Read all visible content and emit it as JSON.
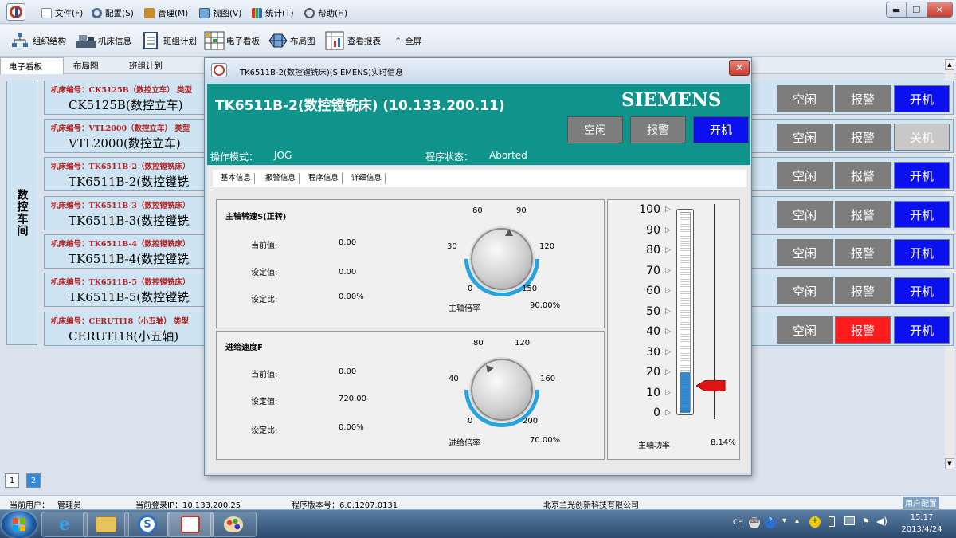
{
  "menu": {
    "items": [
      "文件(F)",
      "配置(S)",
      "管理(M)",
      "视图(V)",
      "统计(T)",
      "帮助(H)"
    ]
  },
  "window_controls": {
    "minimize": "▬",
    "restore": "❐",
    "close": "✕"
  },
  "toolbar": {
    "items": [
      "组织结构",
      "机床信息",
      "班组计划",
      "电子看板",
      "布局图",
      "查看报表",
      "全屏"
    ]
  },
  "tabs": [
    "电子看板",
    "布局图",
    "班组计划"
  ],
  "workshop_label": "数控车间",
  "machines": [
    {
      "code": "机床编号：CK5125B（数控立车）  类型",
      "name": "CK5125B(数控立车)",
      "idle": "空闲",
      "alarm": "报警",
      "power": "开机",
      "alarm_active": false,
      "power_on": true
    },
    {
      "code": "机床编号：VTL2000（数控立车）  类型",
      "name": "VTL2000(数控立车)",
      "idle": "空闲",
      "alarm": "报警",
      "power": "关机",
      "alarm_active": false,
      "power_on": false
    },
    {
      "code": "机床编号：TK6511B-2（数控镗铣床）",
      "name": "TK6511B-2(数控镗铣",
      "idle": "空闲",
      "alarm": "报警",
      "power": "开机",
      "alarm_active": false,
      "power_on": true
    },
    {
      "code": "机床编号：TK6511B-3（数控镗铣床）",
      "name": "TK6511B-3(数控镗铣",
      "idle": "空闲",
      "alarm": "报警",
      "power": "开机",
      "alarm_active": false,
      "power_on": true
    },
    {
      "code": "机床编号：TK6511B-4（数控镗铣床）",
      "name": "TK6511B-4(数控镗铣",
      "idle": "空闲",
      "alarm": "报警",
      "power": "开机",
      "alarm_active": false,
      "power_on": true
    },
    {
      "code": "机床编号：TK6511B-5（数控镗铣床）",
      "name": "TK6511B-5(数控镗铣",
      "idle": "空闲",
      "alarm": "报警",
      "power": "开机",
      "alarm_active": false,
      "power_on": true
    },
    {
      "code": "机床编号：CERUTI18（小五轴）  类型",
      "name": "CERUTI18(小五轴)",
      "idle": "空闲",
      "alarm": "报警",
      "power": "开机",
      "alarm_active": true,
      "power_on": true
    }
  ],
  "pager": {
    "pages": [
      "1",
      "2"
    ],
    "current": "2"
  },
  "status": {
    "user_label": "当前用户：",
    "user": "管理员",
    "ip_label": "当前登录IP：10.133.200.25",
    "version_label": "程序版本号：6.0.1207.0131",
    "company": "北京兰光创新科技有限公司",
    "config": "用户配置"
  },
  "taskbar": {
    "tray_lang": "CH",
    "time": "15:17",
    "date": "2013/4/24"
  },
  "dialog": {
    "title": "TK6511B-2(数控镗铣床)(SIEMENS)实时信息",
    "close": "✕",
    "machine_title": "TK6511B-2(数控镗铣床) (10.133.200.11)",
    "brand": "SIEMENS",
    "buttons": {
      "idle": "空闲",
      "alarm": "报警",
      "power": "开机"
    },
    "op_mode_label": "操作模式：",
    "op_mode": "JOG",
    "prog_state_label": "程序状态：",
    "prog_state": "Aborted",
    "subtabs": [
      "基本信息",
      "报警信息",
      "程序信息",
      "详细信息"
    ],
    "spindle": {
      "title": "主轴转速S(正转)",
      "current_label": "当前值:",
      "current": "0.00",
      "set_label": "设定值:",
      "set": "0.00",
      "ratio_label": "设定比:",
      "ratio": "0.00%",
      "dial_ticks": [
        "0",
        "30",
        "60",
        "90",
        "120",
        "150"
      ],
      "override_label": "主轴倍率",
      "override": "90.00%",
      "override_value": 90
    },
    "feed": {
      "title": "进给速度F",
      "current_label": "当前值:",
      "current": "0.00",
      "set_label": "设定值:",
      "set": "720.00",
      "ratio_label": "设定比:",
      "ratio": "0.00%",
      "dial_ticks": [
        "0",
        "40",
        "80",
        "120",
        "160",
        "200"
      ],
      "override_label": "进给倍率",
      "override": "70.00%",
      "override_value": 70
    },
    "power": {
      "scale": [
        "100",
        "90",
        "80",
        "70",
        "60",
        "50",
        "40",
        "30",
        "20",
        "10",
        "0"
      ],
      "label": "主轴功率",
      "value": "8.14%",
      "fraction": 0.0814,
      "accent": "#1478c8",
      "pointer_color": "#e01414"
    }
  },
  "colors": {
    "idle": "#7d7d7d",
    "alarm_active": "#ff1c1c",
    "power_on": "#0a10f0",
    "power_off": "#c8c8c8",
    "header_teal": "#0f938b",
    "machine_code": "#b22020"
  }
}
